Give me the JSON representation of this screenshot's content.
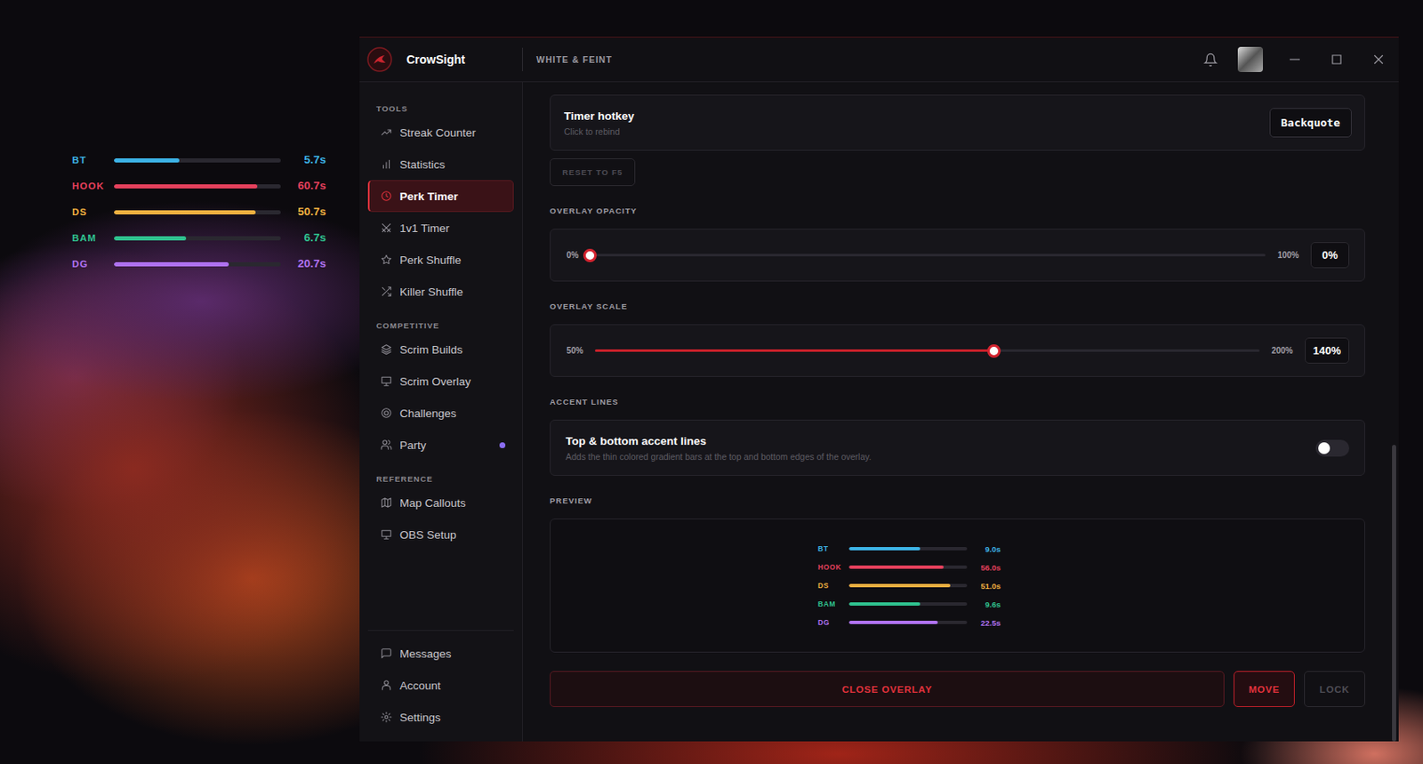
{
  "desktop_overlay": {
    "bars": [
      {
        "label": "BT",
        "reading": "5.7s",
        "level": 0.39,
        "color": "#3db3e6"
      },
      {
        "label": "HOOK",
        "reading": "60.7s",
        "level": 0.86,
        "color": "#e4405c"
      },
      {
        "label": "DS",
        "reading": "50.7s",
        "level": 0.85,
        "color": "#f0b040"
      },
      {
        "label": "BAM",
        "reading": "6.7s",
        "level": 0.43,
        "color": "#2fc28f"
      },
      {
        "label": "DG",
        "reading": "20.7s",
        "level": 0.69,
        "color": "#b072f2"
      }
    ]
  },
  "window": {
    "app_name": "CrowSight",
    "subtitle": "WHITE & FEINT"
  },
  "sidebar": {
    "sections": [
      {
        "title": "TOOLS",
        "items": [
          {
            "label": "Streak Counter",
            "selected": false,
            "dot": false
          },
          {
            "label": "Statistics",
            "selected": false,
            "dot": false
          },
          {
            "label": "Perk Timer",
            "selected": true,
            "dot": false
          },
          {
            "label": "1v1 Timer",
            "selected": false,
            "dot": false
          },
          {
            "label": "Perk Shuffle",
            "selected": false,
            "dot": false
          },
          {
            "label": "Killer Shuffle",
            "selected": false,
            "dot": false
          }
        ]
      },
      {
        "title": "COMPETITIVE",
        "items": [
          {
            "label": "Scrim Builds",
            "selected": false,
            "dot": false
          },
          {
            "label": "Scrim Overlay",
            "selected": false,
            "dot": false
          },
          {
            "label": "Challenges",
            "selected": false,
            "dot": false
          },
          {
            "label": "Party",
            "selected": false,
            "dot": true
          }
        ]
      },
      {
        "title": "REFERENCE",
        "items": [
          {
            "label": "Map Callouts",
            "selected": false,
            "dot": false
          },
          {
            "label": "OBS Setup",
            "selected": false,
            "dot": false
          }
        ]
      }
    ],
    "bottom_items": [
      {
        "label": "Messages",
        "selected": false
      },
      {
        "label": "Account",
        "selected": false
      },
      {
        "label": "Settings",
        "selected": false
      }
    ]
  },
  "settings": {
    "hotkey": {
      "title": "Timer hotkey",
      "hint": "Click to rebind",
      "key": "Backquote"
    },
    "reset_button": {
      "label": "RESET TO F5",
      "disabled": true
    },
    "sliders": [
      {
        "section": "OVERLAY OPACITY",
        "min_label": "0%",
        "max_label": "100%",
        "value": "0%",
        "level": 0
      },
      {
        "section": "OVERLAY SCALE",
        "min_label": "50%",
        "max_label": "200%",
        "value": "140%",
        "level": 0.6
      }
    ],
    "accent": {
      "section": "ACCENT LINES",
      "title": "Top & bottom accent lines",
      "description": "Adds the thin colored gradient bars at the top and bottom edges of the overlay.",
      "on": false
    },
    "preview": {
      "section": "PREVIEW",
      "bars": [
        {
          "label": "BT",
          "reading": "9.0s",
          "level": 0.6,
          "color": "#3db3e6"
        },
        {
          "label": "HOOK",
          "reading": "56.0s",
          "level": 0.8,
          "color": "#e4405c"
        },
        {
          "label": "DS",
          "reading": "51.0s",
          "level": 0.855,
          "color": "#f0b040"
        },
        {
          "label": "BAM",
          "reading": "9.6s",
          "level": 0.6,
          "color": "#2fc28f"
        },
        {
          "label": "DG",
          "reading": "22.5s",
          "level": 0.75,
          "color": "#b072f2"
        }
      ]
    },
    "buttons": [
      {
        "label": "CLOSE OVERLAY",
        "kind": "wide",
        "disabled": false
      },
      {
        "label": "MOVE",
        "kind": "compact",
        "disabled": false
      },
      {
        "label": "LOCK",
        "kind": "compact",
        "disabled": true
      }
    ]
  },
  "scrollbar": {
    "level": 1
  }
}
